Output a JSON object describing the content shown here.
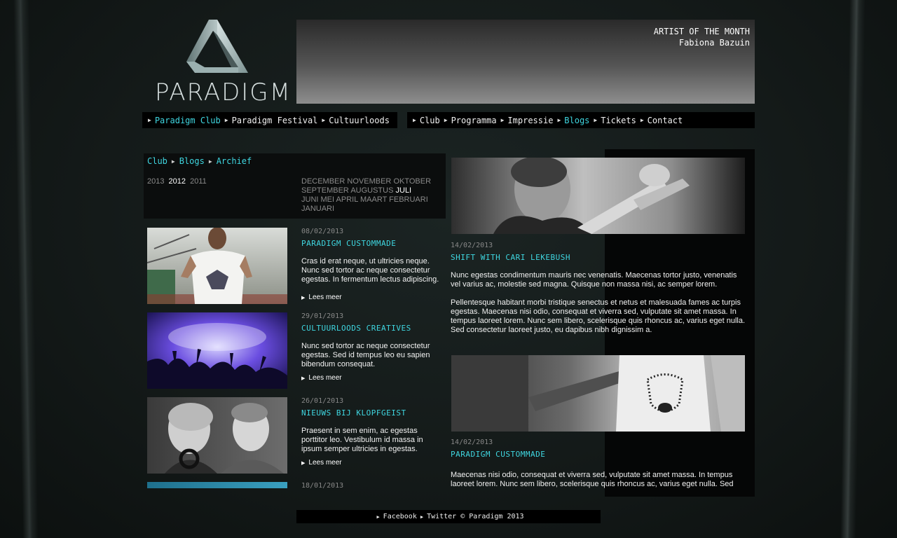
{
  "logo": {
    "text": "PARADIGM"
  },
  "banner": {
    "title": "ARTIST OF THE MONTH",
    "name": "Fabiona Bazuin"
  },
  "nav_left": [
    {
      "label": "Paradigm Club",
      "active": true
    },
    {
      "label": "Paradigm Festival",
      "active": false
    },
    {
      "label": "Cultuurloods",
      "active": false
    }
  ],
  "nav_right": [
    {
      "label": "Club",
      "active": false
    },
    {
      "label": "Programma",
      "active": false
    },
    {
      "label": "Impressie",
      "active": false
    },
    {
      "label": "Blogs",
      "active": true
    },
    {
      "label": "Tickets",
      "active": false
    },
    {
      "label": "Contact",
      "active": false
    }
  ],
  "breadcrumb": [
    "Club",
    "Blogs",
    "Archief"
  ],
  "years": [
    {
      "label": "2013",
      "current": false
    },
    {
      "label": "2012",
      "current": true
    },
    {
      "label": "2011",
      "current": false
    }
  ],
  "months": [
    {
      "label": "DECEMBER",
      "current": false
    },
    {
      "label": "NOVEMBER",
      "current": false
    },
    {
      "label": "OKTOBER",
      "current": false
    },
    {
      "label": "SEPTEMBER",
      "current": false
    },
    {
      "label": "AUGUSTUS",
      "current": false
    },
    {
      "label": "JULI",
      "current": true
    },
    {
      "label": "JUNI",
      "current": false
    },
    {
      "label": "MEI",
      "current": false
    },
    {
      "label": "APRIL",
      "current": false
    },
    {
      "label": "MAART",
      "current": false
    },
    {
      "label": "FEBRUARI",
      "current": false
    },
    {
      "label": "JANUARI",
      "current": false
    }
  ],
  "posts": [
    {
      "date": "08/02/2013",
      "title": "PARADIGM CUSTOMMADE",
      "excerpt": "Cras id erat neque, ut ultricies neque. Nunc sed tortor ac neque consectetur egestas. In fermentum lectus adipiscing.",
      "more": "Lees meer"
    },
    {
      "date": "29/01/2013",
      "title": "CULTUURLOODS CREATIVES",
      "excerpt": "Nunc sed tortor ac neque consectetur egestas. Sed id tempus leo eu sapien bibendum consequat.",
      "more": "Lees meer"
    },
    {
      "date": "26/01/2013",
      "title": "NIEUWS BIJ KLOPFGEIST",
      "excerpt": "Praesent in sem enim, ac egestas porttitor leo. Vestibulum id massa in ipsum semper ultricies in egestas.",
      "more": "Lees meer"
    },
    {
      "date": "18/01/2013"
    }
  ],
  "featured": [
    {
      "date": "14/02/2013",
      "title": "SHIFT WITH CARI LEKEBUSH",
      "para1": "Nunc egestas condimentum mauris nec venenatis. Maecenas tortor justo, venenatis vel varius ac, molestie sed magna. Quisque non massa nisi, ac semper lorem.",
      "para2": "Pellentesque habitant morbi tristique senectus et netus et malesuada fames ac turpis egestas. Maecenas nisi odio, consequat et viverra sed, vulputate sit amet massa. In tempus laoreet lorem. Nunc sem libero, scelerisque quis rhoncus ac, varius eget nulla. Sed consectetur laoreet justo, eu dapibus nibh dignissim a."
    },
    {
      "date": "14/02/2013",
      "title": "PARADIGM CUSTOMMADE",
      "para1": "Maecenas nisi odio, consequat et viverra sed, vulputate sit amet massa. In tempus laoreet lorem. Nunc sem libero, scelerisque quis rhoncus ac, varius eget nulla. Sed"
    }
  ],
  "footer": {
    "facebook": "Facebook",
    "twitter": "Twitter",
    "copyright": "© Paradigm 2013"
  },
  "colors": {
    "accent": "#3fd6e0",
    "background": "#151b1a",
    "bar": "#000000"
  }
}
